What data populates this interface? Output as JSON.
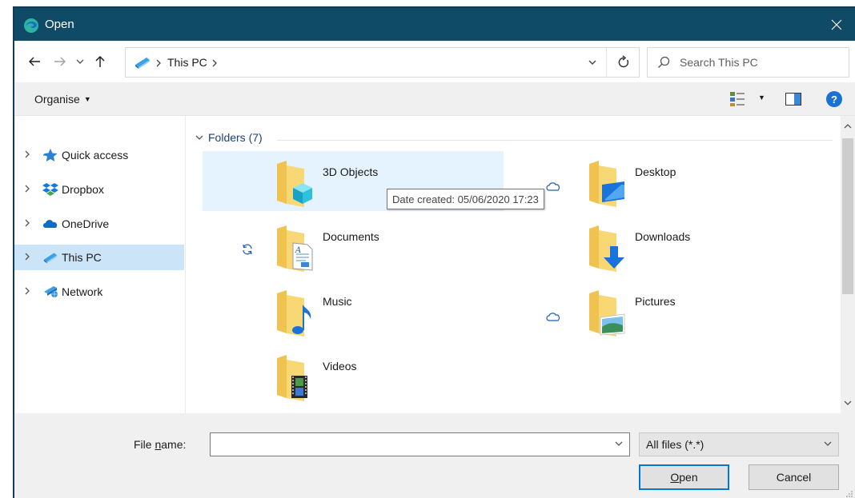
{
  "window": {
    "title": "Open"
  },
  "address": {
    "crumbs": [
      "This PC"
    ],
    "separator": ">"
  },
  "search": {
    "placeholder": "Search This PC"
  },
  "command_bar": {
    "organise_label": "Organise"
  },
  "nav": {
    "items": [
      {
        "label": "Quick access",
        "icon": "star-icon"
      },
      {
        "label": "Dropbox",
        "icon": "dropbox-icon"
      },
      {
        "label": "OneDrive",
        "icon": "cloud-icon"
      },
      {
        "label": "This PC",
        "icon": "computer-icon",
        "selected": true
      },
      {
        "label": "Network",
        "icon": "network-icon"
      }
    ]
  },
  "content": {
    "group_header": "Folders (7)",
    "folders": [
      {
        "name": "3D Objects"
      },
      {
        "name": "Desktop"
      },
      {
        "name": "Documents"
      },
      {
        "name": "Downloads"
      },
      {
        "name": "Music"
      },
      {
        "name": "Pictures"
      },
      {
        "name": "Videos"
      }
    ],
    "tooltip": "Date created: 05/06/2020 17:23"
  },
  "footer": {
    "file_name_label_prefix": "File ",
    "file_name_label_accel": "n",
    "file_name_label_suffix": "ame:",
    "file_name_value": "",
    "filter_value": "All files (*.*)",
    "open_accel": "O",
    "open_rest": "pen",
    "cancel_label": "Cancel"
  },
  "colors": {
    "titlebar": "#0f4a66",
    "selection": "#cce4f7",
    "hover": "#e5f3ff",
    "accent": "#0078d7",
    "folder": "#f8d775"
  }
}
